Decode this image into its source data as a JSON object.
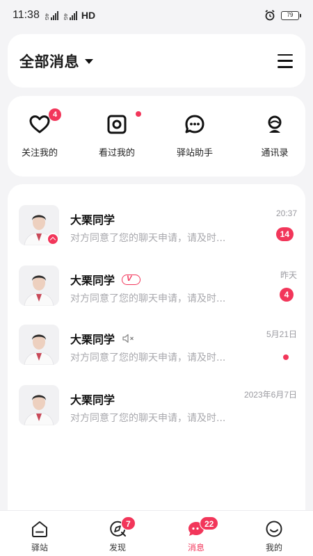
{
  "status_bar": {
    "time": "11:38",
    "network_1": "4G",
    "network_2": "4G",
    "hd": "HD",
    "battery": "79"
  },
  "header": {
    "title": "全部消息",
    "menu_icon": "hamburger-menu-icon"
  },
  "quick_actions": [
    {
      "label": "关注我的",
      "icon": "heart-icon",
      "badge": "4"
    },
    {
      "label": "看过我的",
      "icon": "eye-frame-icon",
      "dot": true
    },
    {
      "label": "驿站助手",
      "icon": "chat-bubble-icon"
    },
    {
      "label": "通讯录",
      "icon": "contacts-icon"
    }
  ],
  "messages": [
    {
      "name": "大栗同学",
      "preview": "对方同意了您的聊天申请，请及时...",
      "time": "20:37",
      "badge": "14",
      "avatar_badge": true
    },
    {
      "name": "大栗同学",
      "preview": "对方同意了您的聊天申请，请及时...",
      "time": "昨天",
      "badge": "4",
      "tag": "vip-tag",
      "tag_text": "V"
    },
    {
      "name": "大栗同学",
      "preview": "对方同意了您的聊天申请，请及时...",
      "time": "5月21日",
      "dot": true,
      "tag": "mute-icon"
    },
    {
      "name": "大栗同学",
      "preview": "对方同意了您的聊天申请，请及时...",
      "time": "2023年6月7日"
    }
  ],
  "bottom_nav": [
    {
      "label": "驿站",
      "icon": "home-icon"
    },
    {
      "label": "发现",
      "icon": "discover-icon",
      "badge": "7"
    },
    {
      "label": "消息",
      "icon": "message-icon",
      "badge": "22",
      "active": true
    },
    {
      "label": "我的",
      "icon": "profile-icon"
    }
  ],
  "colors": {
    "accent": "#f2365a",
    "background": "#f4f4f6",
    "card": "#ffffff",
    "preview_text": "#a8a8ad"
  }
}
